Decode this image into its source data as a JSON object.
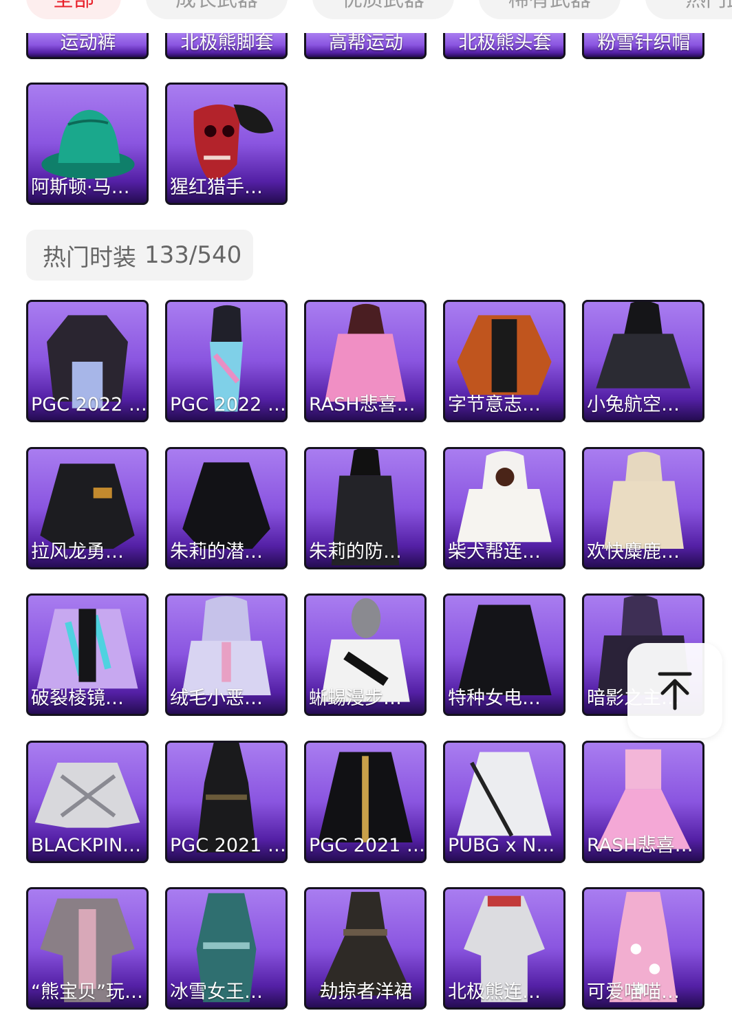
{
  "filter_tabs": [
    {
      "label": "全部",
      "active": true
    },
    {
      "label": "成长武器",
      "active": false
    },
    {
      "label": "优质武器",
      "active": false
    },
    {
      "label": "稀有武器",
      "active": false
    },
    {
      "label": "热门武",
      "active": false
    }
  ],
  "previous_section": {
    "partial_row": [
      "运动裤",
      "北极熊脚套",
      "高帮运动",
      "北极熊头套",
      "粉雪针织帽"
    ],
    "items": [
      "阿斯顿·马…",
      "猩红猎手…"
    ]
  },
  "hot_fashion": {
    "title": "热门时装",
    "count": "133/540",
    "items": [
      "PGC 2022 …",
      "PGC 2022 …",
      "RASH悲喜…",
      "字节意志…",
      "小兔航空…",
      "拉风龙勇…",
      "朱莉的潜…",
      "朱莉的防…",
      "柴犬帮连…",
      "欢快麋鹿…",
      "破裂棱镜…",
      "绒毛小恶…",
      "蜥蜴漫步…",
      "特种女电…",
      "暗影之主…",
      "BLACKPIN…",
      "PGC 2021 …",
      "PGC 2021 …",
      "PUBG x N…",
      "RASH悲喜…",
      "“熊宝贝”玩…",
      "冰雪女王…",
      "劫掠者洋裙",
      "北极熊连…",
      "可爱喵喵…"
    ]
  },
  "back_to_top_icon": "arrow-up-to-line-icon",
  "colors": {
    "accent": "#e8202a",
    "tile_top": "#a97df0",
    "tile_bottom": "#250c52"
  }
}
